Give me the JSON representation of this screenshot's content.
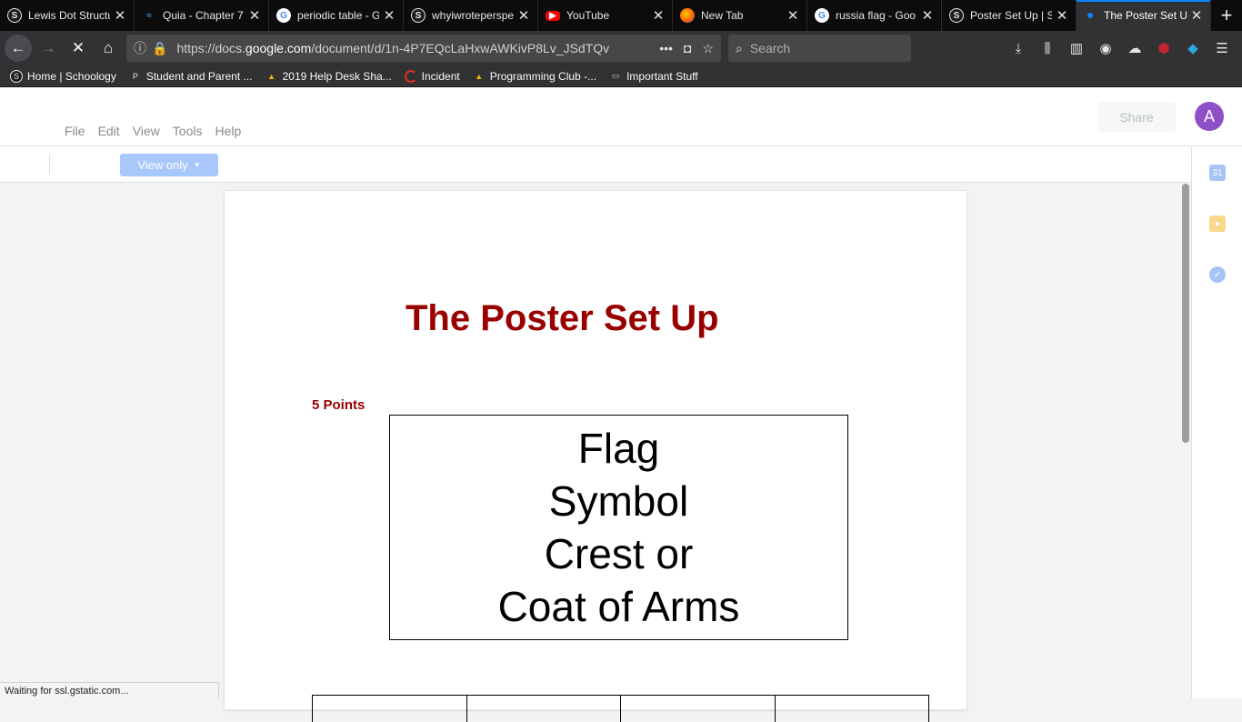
{
  "browser": {
    "tabs": [
      {
        "title": "Lewis Dot Structu",
        "favicon": "schoology-icon"
      },
      {
        "title": "Quia - Chapter 7",
        "favicon": "quia-icon"
      },
      {
        "title": "periodic table - G",
        "favicon": "google-icon"
      },
      {
        "title": "whyiwroteperspe",
        "favicon": "schoology-icon"
      },
      {
        "title": "YouTube",
        "favicon": "youtube-icon"
      },
      {
        "title": "New Tab",
        "favicon": "firefox-icon"
      },
      {
        "title": "russia flag - Goo",
        "favicon": "google-icon"
      },
      {
        "title": "Poster Set Up | S",
        "favicon": "schoology-icon"
      },
      {
        "title": "The Poster Set U",
        "favicon": "loading-dot-icon",
        "active": true
      }
    ],
    "url": {
      "prefix": "https://docs.",
      "domain": "google.com",
      "path": "/document/d/1n-4P7EQcLaHxwAWKivP8Lv_JSdTQv"
    },
    "search_placeholder": "Search",
    "bookmarks": [
      {
        "label": "Home | Schoology",
        "icon": "schoology-icon"
      },
      {
        "label": "Student and Parent ...",
        "icon": "powerschool-icon"
      },
      {
        "label": "2019 Help Desk Sha...",
        "icon": "google-drive-icon"
      },
      {
        "label": "Incident",
        "icon": "incident-icon"
      },
      {
        "label": "Programming Club -...",
        "icon": "google-drive-icon"
      },
      {
        "label": "Important Stuff",
        "icon": "folder-icon"
      }
    ],
    "status_text": "Waiting for ssl.gstatic.com..."
  },
  "docs": {
    "menu": [
      "File",
      "Edit",
      "View",
      "Tools",
      "Help"
    ],
    "share_label": "Share",
    "avatar_letter": "A",
    "view_only_label": "View only",
    "colors": {
      "title": "#990000",
      "accent": "#8e4fc7",
      "view_only": "#a8c7fa"
    }
  },
  "document": {
    "title": "The Poster Set Up",
    "points_label": "5 Points",
    "box_lines": [
      "Flag",
      "Symbol",
      "Crest or",
      "Coat of Arms"
    ]
  }
}
